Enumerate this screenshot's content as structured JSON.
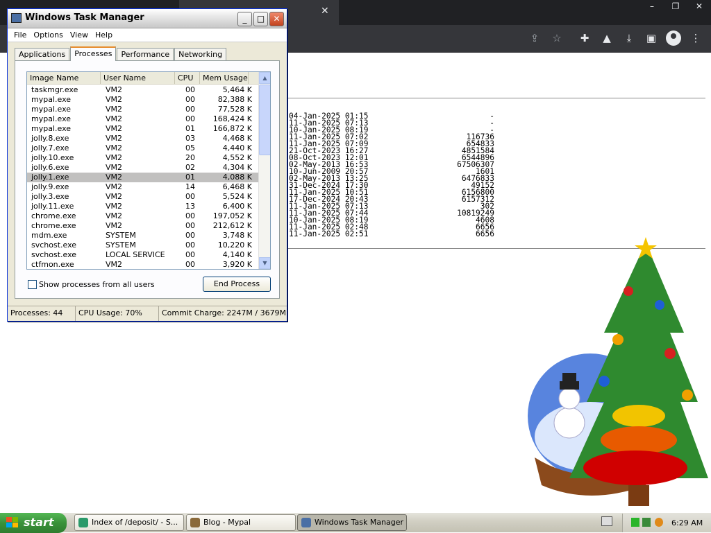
{
  "browser": {
    "tab_close": "✕",
    "window_controls": [
      "–",
      "❐",
      "✕"
    ],
    "toolbar_icons": [
      "share-icon",
      "star-icon",
      "extensions-icon",
      "lab-icon",
      "download-icon",
      "sidebar-icon",
      "profile-icon",
      "menu-icon"
    ]
  },
  "listing": {
    "rows": [
      {
        "date": "04-Jan-2025 01:15",
        "size": "-"
      },
      {
        "date": "11-Jan-2025 07:13",
        "size": "-"
      },
      {
        "date": "10-Jan-2025 08:19",
        "size": "-"
      },
      {
        "date": "11-Jan-2025 07:02",
        "size": "116736"
      },
      {
        "date": "11-Jan-2025 07:09",
        "size": "654833"
      },
      {
        "date": "21-Oct-2023 16:27",
        "size": "4851584"
      },
      {
        "date": "08-Oct-2023 12:01",
        "size": "6544896"
      },
      {
        "date": "02-May-2013 16:53",
        "size": "67506307"
      },
      {
        "date": "10-Jun-2009 20:57",
        "size": "1601"
      },
      {
        "date": "02-May-2013 13:25",
        "size": "6476833"
      },
      {
        "date": "31-Dec-2024 17:30",
        "size": "49152"
      },
      {
        "date": "11-Jan-2025 10:51",
        "size": "6156800"
      },
      {
        "date": "17-Dec-2024 20:43",
        "size": "6157312"
      },
      {
        "date": "11-Jan-2025 07:13",
        "size": "302"
      },
      {
        "date": "11-Jan-2025 07:44",
        "size": "10819249"
      },
      {
        "date": "10-Jan-2025 08:19",
        "size": "4608"
      },
      {
        "date": "11-Jan-2025 02:48",
        "size": "6656"
      },
      {
        "date": "11-Jan-2025 02:51",
        "size": "6656"
      }
    ]
  },
  "taskmgr": {
    "title": "Windows Task Manager",
    "title_buttons": [
      "_",
      "□",
      "✕"
    ],
    "menu": [
      "File",
      "Options",
      "View",
      "Help"
    ],
    "tabs": [
      "Applications",
      "Processes",
      "Performance",
      "Networking"
    ],
    "columns": [
      "Image Name",
      "User Name",
      "CPU",
      "Mem Usage"
    ],
    "processes": [
      {
        "image": "taskmgr.exe",
        "user": "VM2",
        "cpu": "00",
        "mem": "5,464 K"
      },
      {
        "image": "mypal.exe",
        "user": "VM2",
        "cpu": "00",
        "mem": "82,388 K"
      },
      {
        "image": "mypal.exe",
        "user": "VM2",
        "cpu": "00",
        "mem": "77,528 K"
      },
      {
        "image": "mypal.exe",
        "user": "VM2",
        "cpu": "00",
        "mem": "168,424 K"
      },
      {
        "image": "mypal.exe",
        "user": "VM2",
        "cpu": "01",
        "mem": "166,872 K"
      },
      {
        "image": "jolly.8.exe",
        "user": "VM2",
        "cpu": "03",
        "mem": "4,468 K"
      },
      {
        "image": "jolly.7.exe",
        "user": "VM2",
        "cpu": "05",
        "mem": "4,440 K"
      },
      {
        "image": "jolly.10.exe",
        "user": "VM2",
        "cpu": "20",
        "mem": "4,552 K"
      },
      {
        "image": "jolly.6.exe",
        "user": "VM2",
        "cpu": "02",
        "mem": "4,304 K"
      },
      {
        "image": "jolly.1.exe",
        "user": "VM2",
        "cpu": "01",
        "mem": "4,088 K",
        "selected": true
      },
      {
        "image": "jolly.9.exe",
        "user": "VM2",
        "cpu": "14",
        "mem": "6,468 K"
      },
      {
        "image": "jolly.3.exe",
        "user": "VM2",
        "cpu": "00",
        "mem": "5,524 K"
      },
      {
        "image": "jolly.11.exe",
        "user": "VM2",
        "cpu": "13",
        "mem": "6,400 K"
      },
      {
        "image": "chrome.exe",
        "user": "VM2",
        "cpu": "00",
        "mem": "197,052 K"
      },
      {
        "image": "chrome.exe",
        "user": "VM2",
        "cpu": "00",
        "mem": "212,612 K"
      },
      {
        "image": "mdm.exe",
        "user": "SYSTEM",
        "cpu": "00",
        "mem": "3,748 K"
      },
      {
        "image": "svchost.exe",
        "user": "SYSTEM",
        "cpu": "00",
        "mem": "10,220 K"
      },
      {
        "image": "svchost.exe",
        "user": "LOCAL SERVICE",
        "cpu": "00",
        "mem": "4,140 K"
      },
      {
        "image": "ctfmon.exe",
        "user": "VM2",
        "cpu": "00",
        "mem": "3,920 K"
      }
    ],
    "show_all_label": "Show processes from all users",
    "end_process_label": "End Process",
    "status": {
      "processes": "Processes: 44",
      "cpu": "CPU Usage: 70%",
      "commit": "Commit Charge: 2247M / 3679M"
    }
  },
  "taskbar": {
    "start_label": "start",
    "buttons": [
      {
        "label": "Index of /deposit/ - S..."
      },
      {
        "label": "Blog - Mypal"
      },
      {
        "label": "Windows Task Manager"
      }
    ],
    "clock": "6:29 AM"
  },
  "colors": {
    "selection": "#c1c0bf",
    "tab_accent": "#e68b2c",
    "start_green": "#3a923a"
  }
}
